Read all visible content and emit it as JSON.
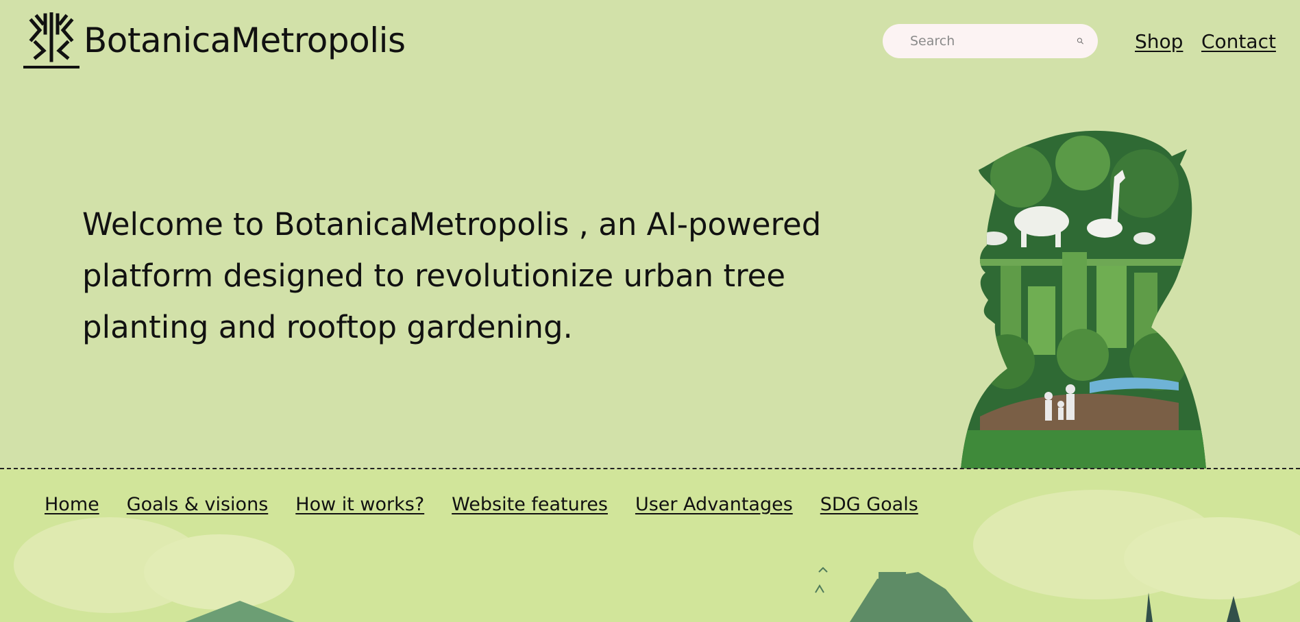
{
  "header": {
    "brand": "BotanicaMetropolis",
    "search": {
      "placeholder": "Search",
      "value": ""
    },
    "links": {
      "shop": "Shop",
      "contact": "Contact"
    }
  },
  "hero": {
    "headline": "Welcome to BotanicaMetropolis , an AI-powered platform designed to revolutionize urban tree planting and rooftop gardening."
  },
  "nav": {
    "home": "Home",
    "goals": "Goals & visions",
    "how": "How it works?",
    "features": "Website features",
    "advantages": "User Advantages",
    "sdg": "SDG Goals"
  },
  "colors": {
    "page_bg": "#d2e1a9",
    "band_bg": "#d1e59a",
    "search_bg": "#fcf3f3",
    "figure_green": "#2f6a34",
    "text": "#111111"
  },
  "icons": [
    "tree-logo-icon",
    "search-icon"
  ]
}
